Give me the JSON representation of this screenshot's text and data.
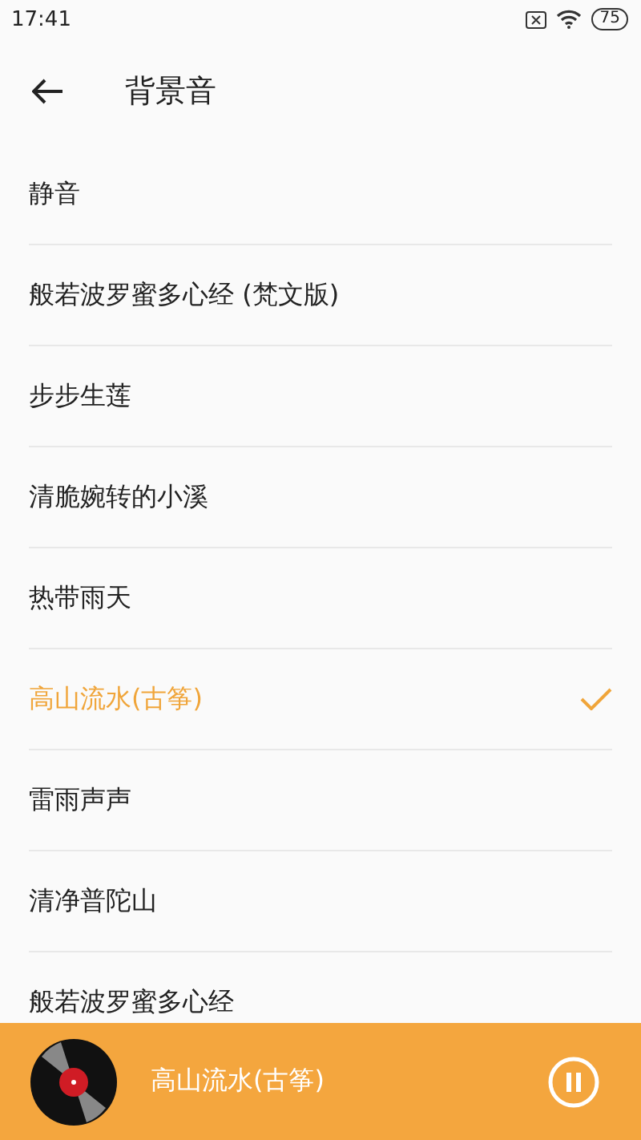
{
  "status_bar": {
    "time": "17:41",
    "battery": "75"
  },
  "header": {
    "title": "背景音"
  },
  "tracks": [
    {
      "name": "静音",
      "selected": false
    },
    {
      "name": "般若波罗蜜多心经 (梵文版)",
      "selected": false
    },
    {
      "name": "步步生莲",
      "selected": false
    },
    {
      "name": "清脆婉转的小溪",
      "selected": false
    },
    {
      "name": "热带雨天",
      "selected": false
    },
    {
      "name": "高山流水(古筝)",
      "selected": true
    },
    {
      "name": "雷雨声声",
      "selected": false
    },
    {
      "name": "清净普陀山",
      "selected": false
    },
    {
      "name": "般若波罗蜜多心经",
      "selected": false
    }
  ],
  "player": {
    "title": "高山流水(古筝)",
    "playing": true
  }
}
